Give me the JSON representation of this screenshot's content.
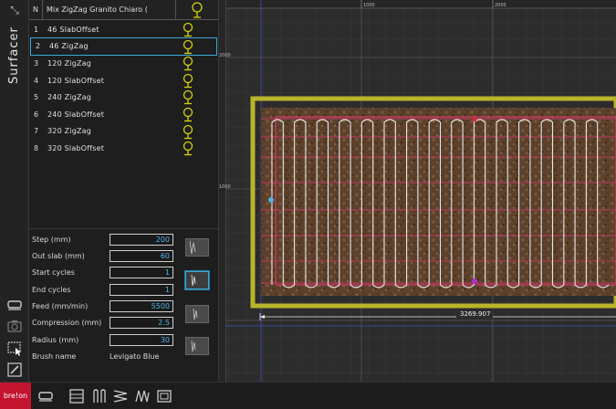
{
  "sidebar": {
    "title": "Surfacer",
    "tools": [
      "expand-icon",
      "roller-icon",
      "camera-icon",
      "select-icon",
      "edit-icon"
    ]
  },
  "program_list": {
    "header_n": "N",
    "header_title": "Mix ZigZag Granito Chiaro (",
    "items": [
      {
        "n": "1",
        "label": "46 SlabOffset"
      },
      {
        "n": "2",
        "label": "46 ZigZag",
        "selected": true
      },
      {
        "n": "3",
        "label": "120 ZigZag"
      },
      {
        "n": "4",
        "label": "120 SlabOffset"
      },
      {
        "n": "5",
        "label": "240 ZigZag"
      },
      {
        "n": "6",
        "label": "240 SlabOffset"
      },
      {
        "n": "7",
        "label": "320 ZigZag"
      },
      {
        "n": "8",
        "label": "320 SlabOffset"
      }
    ],
    "item_icon": "brush-head-icon",
    "icon_color": "#d6d20c"
  },
  "params": {
    "step_label": "Step (mm)",
    "step_value": "200",
    "out_slab_label": "Out slab (mm)",
    "out_slab_value": "60",
    "start_cycles_label": "Start cycles",
    "start_cycles_value": "1",
    "end_cycles_label": "End cycles",
    "end_cycles_value": "1",
    "feed_label": "Feed (mm/min)",
    "feed_value": "5500",
    "compression_label": "Compression (mm)",
    "compression_value": "2.5",
    "radius_label": "Radius (mm)",
    "radius_value": "30",
    "brush_name_label": "Brush name",
    "brush_name_value": "Levigato Blue",
    "value_color": "#4fb4e8"
  },
  "canvas": {
    "ruler_top_1000": "1000",
    "ruler_top_2000": "2000",
    "ruler_left_2000": "2000",
    "ruler_left_1000": "1000",
    "dimension": "3269.907",
    "toolpath_color": "#e8e8e8",
    "frame_color": "#b9b42a"
  },
  "bottom": {
    "brand": "bre!on",
    "tools": [
      "roller-icon",
      "parallel-lines-icon",
      "vertical-pattern-icon",
      "zigzag-horizontal-icon",
      "zigzag-vertical-icon",
      "frame-icon"
    ]
  }
}
